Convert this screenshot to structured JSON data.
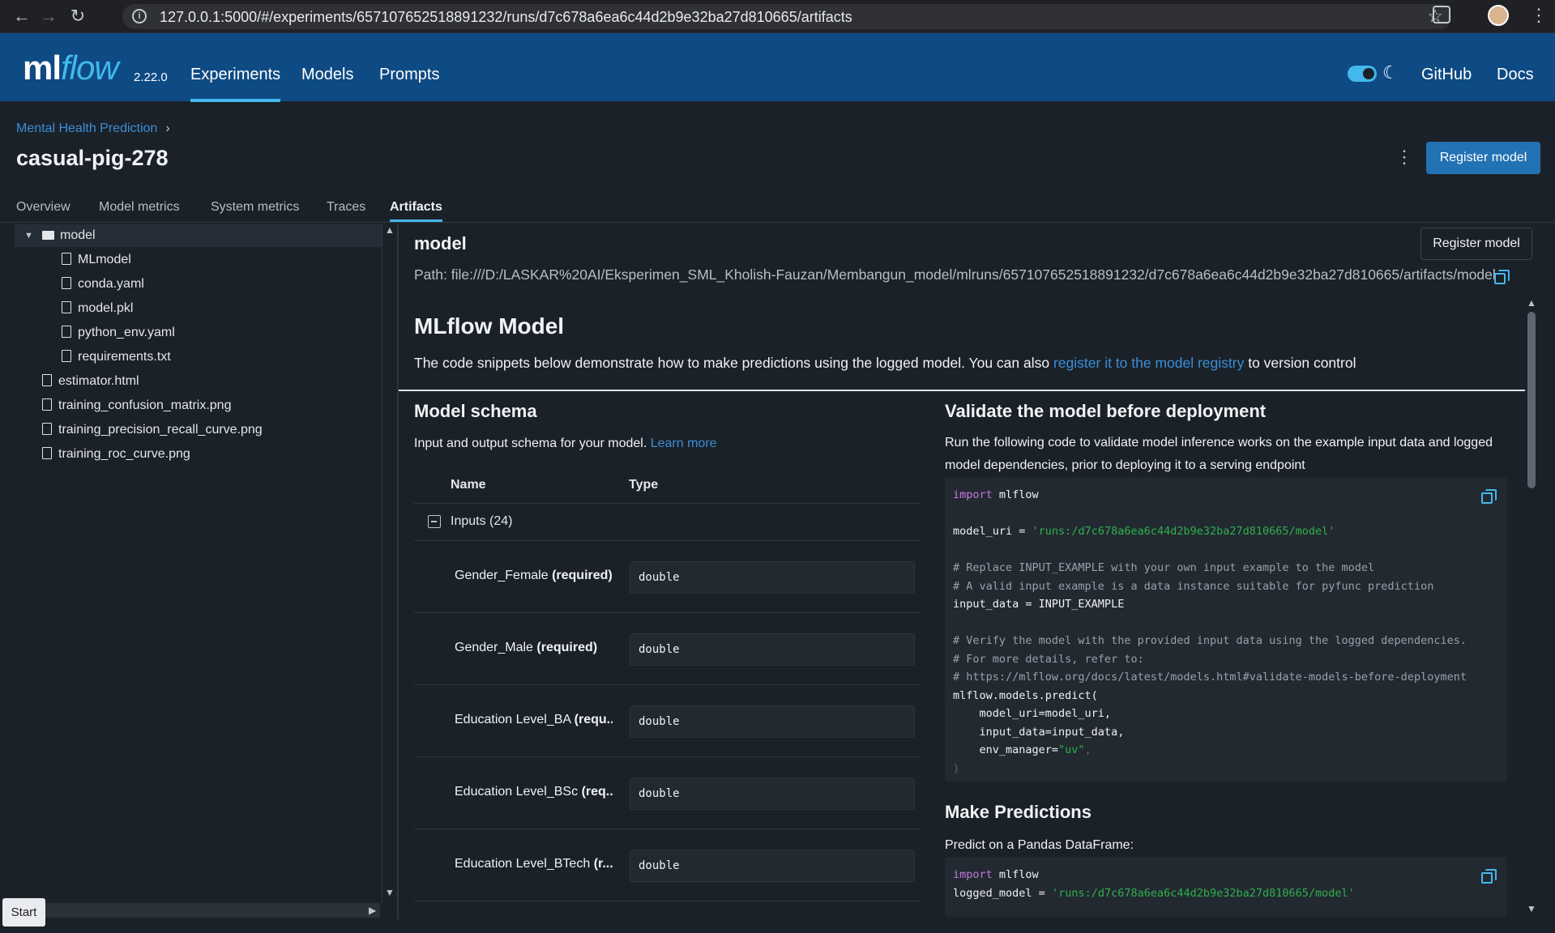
{
  "browser": {
    "url": "127.0.0.1:5000/#/experiments/657107652518891232/runs/d7c678a6ea6c44d2b9e32ba27d810665/artifacts"
  },
  "header": {
    "logo_ml": "ml",
    "logo_flow": "flow",
    "version": "2.22.0",
    "nav": [
      "Experiments",
      "Models",
      "Prompts"
    ],
    "links": [
      "GitHub",
      "Docs"
    ]
  },
  "breadcrumb": "Mental Health Prediction",
  "run_title": "casual-pig-278",
  "register_label": "Register model",
  "tabs": [
    "Overview",
    "Model metrics",
    "System metrics",
    "Traces",
    "Artifacts"
  ],
  "tree": {
    "folder": "model",
    "children": [
      "MLmodel",
      "conda.yaml",
      "model.pkl",
      "python_env.yaml",
      "requirements.txt"
    ],
    "files": [
      "estimator.html",
      "training_confusion_matrix.png",
      "training_precision_recall_curve.png",
      "training_roc_curve.png"
    ]
  },
  "start_label": "Start",
  "artifact": {
    "title": "model",
    "register_label": "Register model",
    "path": "Path: file:///D:/LASKAR%20AI/Eksperimen_SML_Kholish-Fauzan/Membangun_model/mlruns/657107652518891232/d7c678a6ea6c44d2b9e32ba27d810665/artifacts/model",
    "mlflow_heading": "MLflow Model",
    "desc_before": "The code snippets below demonstrate how to make predictions using the logged model. You can also ",
    "desc_link": "register it to the model registry",
    "desc_after": " to version control"
  },
  "schema": {
    "heading": "Model schema",
    "desc": "Input and output schema for your model.",
    "learn_more": "Learn more",
    "col_name": "Name",
    "col_type": "Type",
    "inputs_label": "Inputs (24)",
    "rows": [
      {
        "name": "Gender_Female",
        "req": "(required)",
        "type": "double"
      },
      {
        "name": "Gender_Male",
        "req": "(required)",
        "type": "double"
      },
      {
        "name": "Education Level_BA",
        "req": "(requ...",
        "type": "double"
      },
      {
        "name": "Education Level_BSc",
        "req": "(req...",
        "type": "double"
      },
      {
        "name": "Education Level_BTech",
        "req": "(r...",
        "type": "double"
      }
    ]
  },
  "validate": {
    "heading": "Validate the model before deployment",
    "desc": "Run the following code to validate model inference works on the example input data and logged model dependencies, prior to deploying it to a serving endpoint",
    "code": {
      "import_kw": "import",
      "import_mod": " mlflow",
      "uri_var": "model_uri",
      "uri_val": "'runs:/d7c678a6ea6c44d2b9e32ba27d810665/model'",
      "c1": "# Replace INPUT_EXAMPLE with your own input example to the model",
      "c2": "# A valid input example is a data instance suitable for pyfunc prediction",
      "input_line": "input_data = INPUT_EXAMPLE",
      "c3": "# Verify the model with the provided input data using the logged dependencies.",
      "c4": "# For more details, refer to:",
      "c5": "# https://mlflow.org/docs/latest/models.html#validate-models-before-deployment",
      "predict": "mlflow.models.predict(",
      "a1": "    model_uri=model_uri,",
      "a2": "    input_data=input_data,",
      "a3_key": "    env_manager=",
      "a3_val": "\"uv\"",
      "close": ")"
    }
  },
  "predict": {
    "heading": "Make Predictions",
    "desc": "Predict on a Pandas DataFrame:",
    "code": {
      "import_kw": "import",
      "import_mod": " mlflow",
      "var": "logged_model",
      "val": "'runs:/d7c678a6ea6c44d2b9e32ba27d810665/model'"
    }
  },
  "colors": {
    "accent": "#43b8ec",
    "header_bg": "#0e4a84",
    "primary_btn": "#2272b4",
    "link": "#3b8ed8",
    "bg": "#1b2128"
  }
}
